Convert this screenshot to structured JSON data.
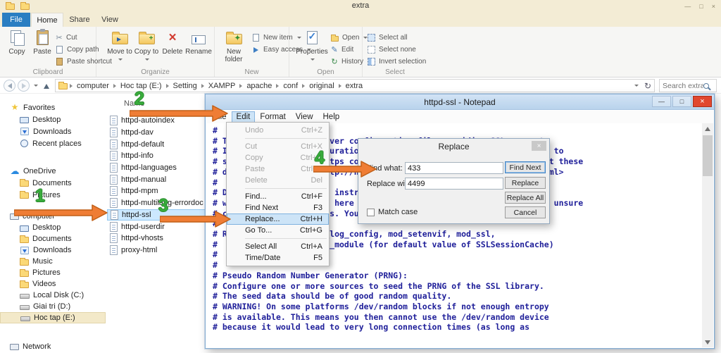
{
  "colors": {
    "file_tab_blue": "#2a7ec2",
    "selection_blue": "#cce8ff",
    "sidebar_selection_cream": "#f3e9c9",
    "notepad_text_navy": "#20209a",
    "notepad_titlebar_blue": "#bcd6ee",
    "arrow_orange": "#EF7D35",
    "number_green": "#39AC3C",
    "titlebar_cream": "#f3ecd5"
  },
  "explorer": {
    "title": "extra",
    "tabs": [
      "File",
      "Home",
      "Share",
      "View"
    ],
    "ribbon": {
      "clipboard": {
        "label": "Clipboard",
        "copy": "Copy",
        "paste": "Paste",
        "cut": "Cut",
        "copy_path": "Copy path",
        "paste_shortcut": "Paste shortcut"
      },
      "organize": {
        "label": "Organize",
        "move_to": "Move to",
        "copy_to": "Copy to",
        "delete": "Delete",
        "rename": "Rename"
      },
      "new": {
        "label": "New",
        "new_folder": "New folder",
        "new_item": "New item",
        "easy_access": "Easy access"
      },
      "open": {
        "label": "Open",
        "properties": "Properties",
        "open": "Open",
        "edit": "Edit",
        "history": "History"
      },
      "select": {
        "label": "Select",
        "select_all": "Select all",
        "select_none": "Select none",
        "invert_selection": "Invert selection"
      }
    },
    "breadcrumbs": [
      "computer",
      "Hoc tap (E:)",
      "Setting",
      "XAMPP",
      "apache",
      "conf",
      "original",
      "extra"
    ],
    "search_placeholder": "Search extra",
    "sidebar": {
      "favorites": {
        "label": "Favorites",
        "items": [
          "Desktop",
          "Downloads",
          "Recent places"
        ]
      },
      "onedrive": {
        "label": "OneDrive",
        "items": [
          "Documents",
          "Pictures"
        ]
      },
      "computer": {
        "label": "computer",
        "items": [
          "Desktop",
          "Documents",
          "Downloads",
          "Music",
          "Pictures",
          "Videos",
          "Local Disk (C:)",
          "Giai tri (D:)",
          "Hoc tap (E:)"
        ]
      },
      "network": {
        "label": "Network"
      },
      "selected_item": "Hoc tap (E:)"
    },
    "file_list": {
      "column_name": "Name",
      "files": [
        "httpd-autoindex",
        "httpd-dav",
        "httpd-default",
        "httpd-info",
        "httpd-languages",
        "httpd-manual",
        "httpd-mpm",
        "httpd-multilang-errordoc",
        "httpd-ssl",
        "httpd-userdir",
        "httpd-vhosts",
        "proxy-html"
      ],
      "selected_file": "httpd-ssl"
    }
  },
  "notepad": {
    "title": "httpd-ssl - Notepad",
    "menus": [
      "File",
      "Edit",
      "Format",
      "View",
      "Help"
    ],
    "open_menu": "Edit",
    "edit_menu": {
      "items": [
        {
          "label": "Undo",
          "shortcut": "Ctrl+Z",
          "state": "disabled"
        },
        {
          "label": "Cut",
          "shortcut": "Ctrl+X",
          "state": "disabled"
        },
        {
          "label": "Copy",
          "shortcut": "Ctrl+C",
          "state": "disabled"
        },
        {
          "label": "Paste",
          "shortcut": "Ctrl+V",
          "state": "disabled"
        },
        {
          "label": "Delete",
          "shortcut": "Del",
          "state": "disabled"
        },
        {
          "label": "Find...",
          "shortcut": "Ctrl+F",
          "state": "normal"
        },
        {
          "label": "Find Next",
          "shortcut": "F3",
          "state": "normal"
        },
        {
          "label": "Replace...",
          "shortcut": "Ctrl+H",
          "state": "highlighted"
        },
        {
          "label": "Go To...",
          "shortcut": "Ctrl+G",
          "state": "normal"
        },
        {
          "label": "Select All",
          "shortcut": "Ctrl+A",
          "state": "normal"
        },
        {
          "label": "Time/Date",
          "shortcut": "F5",
          "state": "normal"
        }
      ]
    },
    "content": "#\n# This is the Apache server configuration file providing SSL support.\n# It contains the configuration directives to instruct the server how to\n# serve pages over an https connection. For detailed information about these\n# directives see <URL:http://httpd.apache.org/docs/2.4/mod/mod_ssl.html>\n#\n# Do NOT simply read the instructions in here without understanding\n# what they do.  They're here only as hints or reminders.  If you are unsure\n# consult the online docs. You have been warned.\n#\n# Required modules: mod_log_config, mod_setenvif, mod_ssl,\n#          socache_shmcb_module (for default value of SSLSessionCache)\n#\n#\n# Pseudo Random Number Generator (PRNG):\n# Configure one or more sources to seed the PRNG of the SSL library.\n# The seed data should be of good random quality.\n# WARNING! On some platforms /dev/random blocks if not enough entropy\n# is available. This means you then cannot use the /dev/random device\n# because it would lead to very long connection times (as long as"
  },
  "replace_dialog": {
    "title": "Replace",
    "find_what_label": "Find what:",
    "find_what_value": "433",
    "replace_with_label": "Replace with:",
    "replace_with_value": "4499",
    "find_next_button": "Find Next",
    "replace_button": "Replace",
    "replace_all_button": "Replace All",
    "cancel_button": "Cancel",
    "match_case_label": "Match case"
  },
  "annotations": {
    "steps": [
      "1",
      "2",
      "3",
      "4"
    ]
  },
  "icons": {
    "minimize": "—",
    "maximize": "□",
    "close": "×",
    "refresh": "↻",
    "star": "★",
    "cloud": "☁",
    "scissors": "✂",
    "pencil": "✎",
    "history": "↻"
  }
}
